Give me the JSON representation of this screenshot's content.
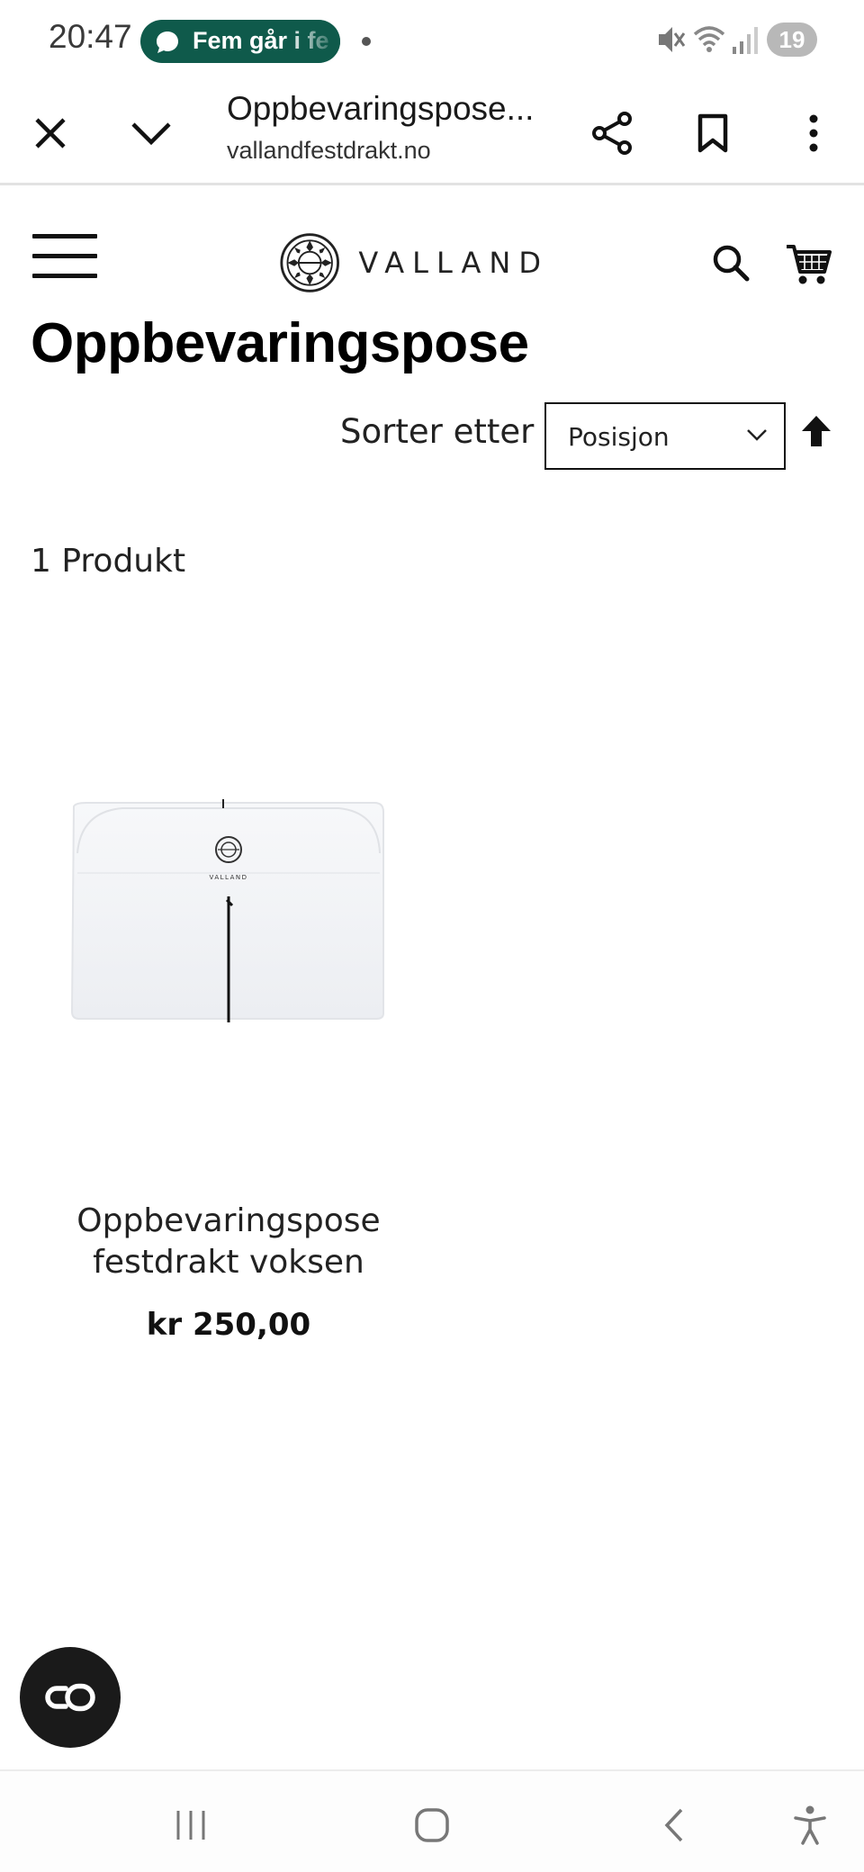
{
  "status_bar": {
    "time": "20:47",
    "notification_text": "Fem går i fe",
    "battery": "19",
    "icons": [
      "mute-icon",
      "wifi-icon",
      "signal-icon"
    ]
  },
  "browser": {
    "title": "Oppbevaringspose...",
    "url": "vallandfestdrakt.no",
    "icons": [
      "close-icon",
      "chevron-down-icon",
      "share-icon",
      "bookmark-icon",
      "more-icon"
    ]
  },
  "header": {
    "logo_text": "VALLAND"
  },
  "page": {
    "title": "Oppbevaringspose"
  },
  "sort": {
    "label": "Sorter etter",
    "selected": "Posisjon"
  },
  "listing": {
    "count_text": "1 Produkt",
    "products": [
      {
        "name": "Oppbevaringspose festdrakt voksen",
        "price": "kr 250,00",
        "image_logo_text": "VALLAND"
      }
    ]
  },
  "colors": {
    "notification_pill": "#0f5a4b",
    "chat_fab": "#1a1a1a",
    "text": "#111111"
  }
}
